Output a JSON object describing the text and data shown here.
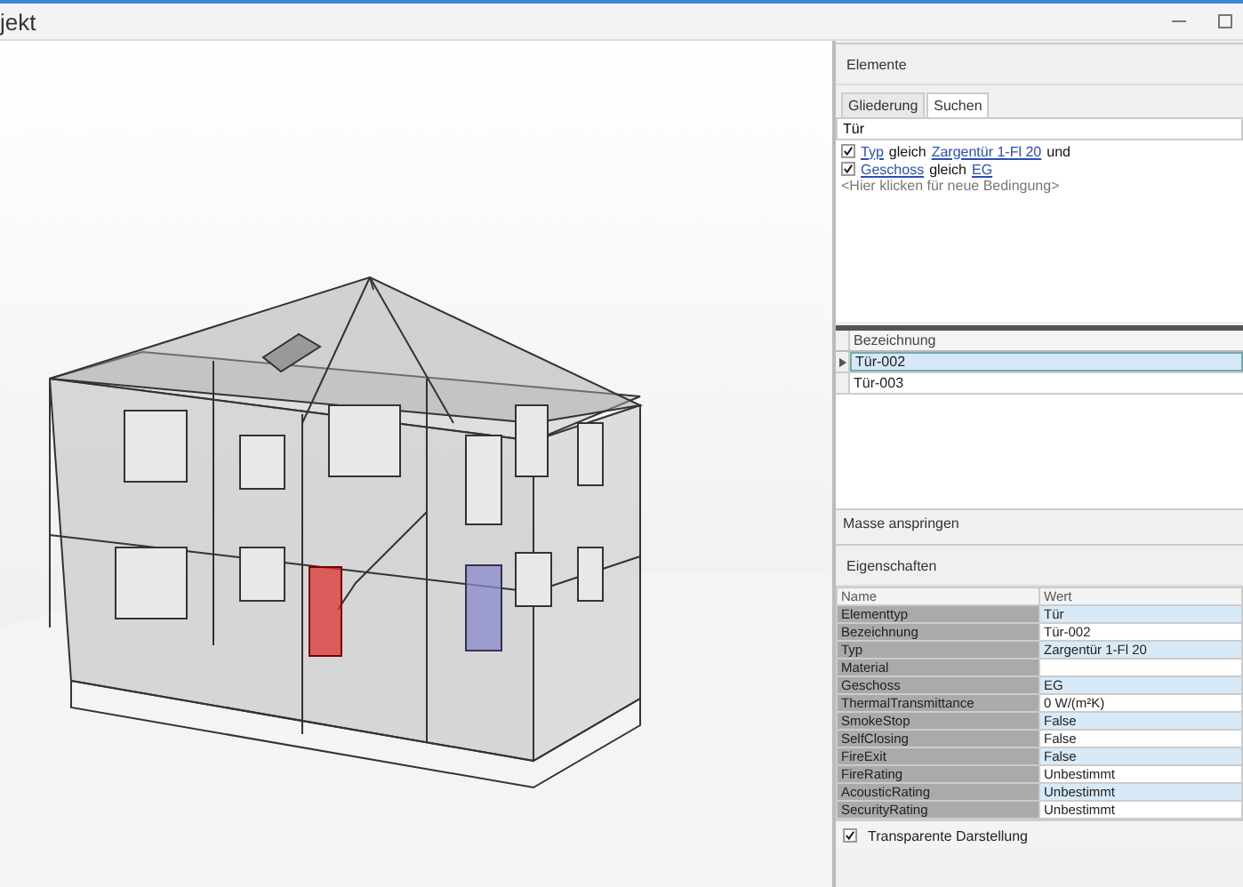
{
  "window": {
    "title": "jekt"
  },
  "elements_panel": {
    "title": "Elemente",
    "tabs": [
      {
        "label": "Gliederung",
        "selected": false
      },
      {
        "label": "Suchen",
        "selected": true
      }
    ],
    "search": {
      "value": "Tür"
    },
    "conditions": [
      {
        "checked": true,
        "field": "Typ",
        "operator": "gleich",
        "value": "Zargentür 1-Fl 20",
        "joiner": "und"
      },
      {
        "checked": true,
        "field": "Geschoss",
        "operator": "gleich",
        "value": "EG"
      }
    ],
    "add_condition": "<Hier klicken für neue Bedingung>",
    "results": {
      "column": "Bezeichnung",
      "rows": [
        {
          "label": "Tür-002",
          "selected": true
        },
        {
          "label": "Tür-003",
          "selected": false
        }
      ]
    },
    "jump_button": "Masse anspringen"
  },
  "properties_panel": {
    "title": "Eigenschaften",
    "columns": [
      "Name",
      "Wert"
    ],
    "rows": [
      [
        "Elementtyp",
        "Tür"
      ],
      [
        "Bezeichnung",
        "Tür-002"
      ],
      [
        "Typ",
        "Zargentür 1-Fl 20"
      ],
      [
        "Material",
        ""
      ],
      [
        "Geschoss",
        "EG"
      ],
      [
        "ThermalTransmittance",
        "0 W/(m²K)"
      ],
      [
        "SmokeStop",
        "False"
      ],
      [
        "SelfClosing",
        "False"
      ],
      [
        "FireExit",
        "False"
      ],
      [
        "FireRating",
        "Unbestimmt"
      ],
      [
        "AcousticRating",
        "Unbestimmt"
      ],
      [
        "SecurityRating",
        "Unbestimmt"
      ]
    ],
    "transparent": {
      "label": "Transparente Darstellung",
      "checked": true
    }
  }
}
